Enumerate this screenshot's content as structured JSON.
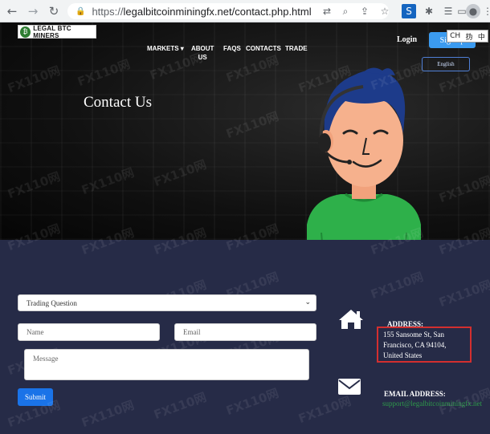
{
  "browser": {
    "url_proto": "https://",
    "url_rest": "legalbitcoinminingfx.net/contact.php.html",
    "back_icon": "arrow-left-icon",
    "forward_icon": "arrow-right-icon",
    "reload_icon": "reload-icon"
  },
  "header": {
    "logo_text": "LEGAL BTC MINERS",
    "nav": [
      {
        "label": "MARKETS ▾"
      },
      {
        "label": "ABOUT\nUS"
      },
      {
        "label": "FAQS"
      },
      {
        "label": "CONTACTS"
      },
      {
        "label": "TRADE"
      }
    ],
    "login": "Login",
    "signup": "Sign up",
    "language": "English",
    "ime_text": [
      "CH",
      "㧑",
      "中"
    ]
  },
  "hero": {
    "title": "Contact Us"
  },
  "form": {
    "subject_selected": "Trading Question",
    "name_placeholder": "Name",
    "email_placeholder": "Email",
    "message_placeholder": "Message",
    "submit_label": "Submit"
  },
  "contact": {
    "address_label": "ADDRESS:",
    "address_value": "155 Sansome St, San Francisco, CA 94104, United States",
    "email_label": "EMAIL ADDRESS:",
    "email_value": "support@legalbitcoinminingfx.net"
  },
  "watermark": "FX110网",
  "colors": {
    "hero_bg": "#0a0a0a",
    "lower_bg": "#262b47",
    "primary_blue": "#1a73e8",
    "highlight_red": "#d32f2f",
    "email_green": "#2e9a4a"
  }
}
